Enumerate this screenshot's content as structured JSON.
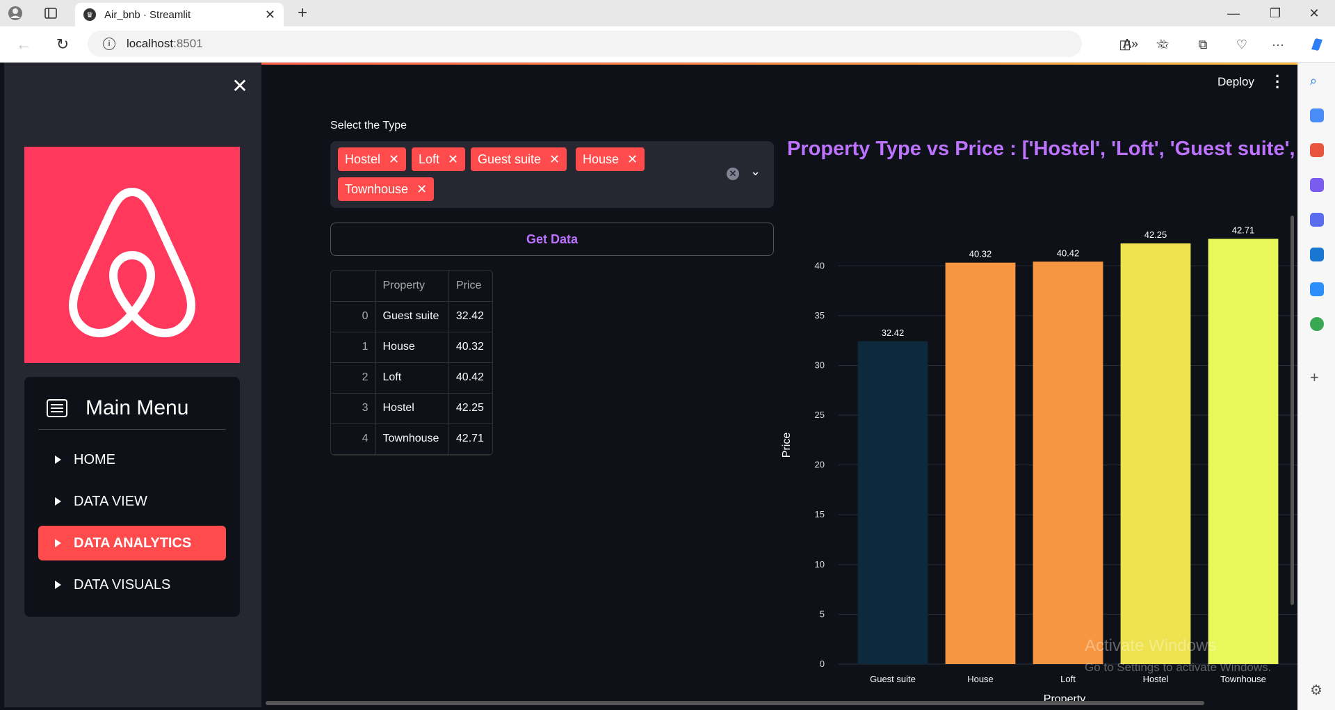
{
  "browser": {
    "tab_title": "Air_bnb · Streamlit",
    "url_host": "localhost",
    "url_port": ":8501"
  },
  "sidebar": {
    "menu_title": "Main Menu",
    "items": [
      {
        "label": "HOME",
        "active": false
      },
      {
        "label": "DATA VIEW",
        "active": false
      },
      {
        "label": "DATA ANALYTICS",
        "active": true
      },
      {
        "label": "DATA VISUALS",
        "active": false
      }
    ]
  },
  "header": {
    "deploy_label": "Deploy"
  },
  "filter": {
    "label": "Select the Type",
    "chips": [
      "Hostel",
      "Loft",
      "Guest suite",
      "House",
      "Townhouse"
    ]
  },
  "button": {
    "get_data_label": "Get Data"
  },
  "table": {
    "columns": [
      "",
      "Property",
      "Price"
    ],
    "rows": [
      [
        "0",
        "Guest suite",
        "32.42"
      ],
      [
        "1",
        "House",
        "40.32"
      ],
      [
        "2",
        "Loft",
        "40.42"
      ],
      [
        "3",
        "Hostel",
        "42.25"
      ],
      [
        "4",
        "Townhouse",
        "42.71"
      ]
    ]
  },
  "chart_data": {
    "type": "bar",
    "title": "Property Type vs Price : ['Hostel', 'Loft', 'Guest suite',",
    "xlabel": "Property",
    "ylabel": "Price",
    "categories": [
      "Guest suite",
      "House",
      "Loft",
      "Hostel",
      "Townhouse"
    ],
    "values": [
      32.42,
      40.32,
      40.42,
      42.25,
      42.71
    ],
    "data_labels": [
      "32.42",
      "40.32",
      "40.42",
      "42.25",
      "42.71"
    ],
    "colors": [
      "#0d2a3c",
      "#f89540",
      "#f89540",
      "#eee24e",
      "#e8f75a"
    ],
    "yticks": [
      0,
      5,
      10,
      15,
      20,
      25,
      30,
      35,
      40
    ],
    "ylim": [
      0,
      44
    ],
    "grid": true
  },
  "watermark": {
    "line1": "Activate Windows",
    "line2": "Go to Settings to activate Windows."
  },
  "colors": {
    "accent": "#ff4b4b",
    "title_purple": "#bd73ff",
    "app_bg": "#0e1117",
    "sidebar_bg": "#262730",
    "airbnb": "#ff385c"
  }
}
